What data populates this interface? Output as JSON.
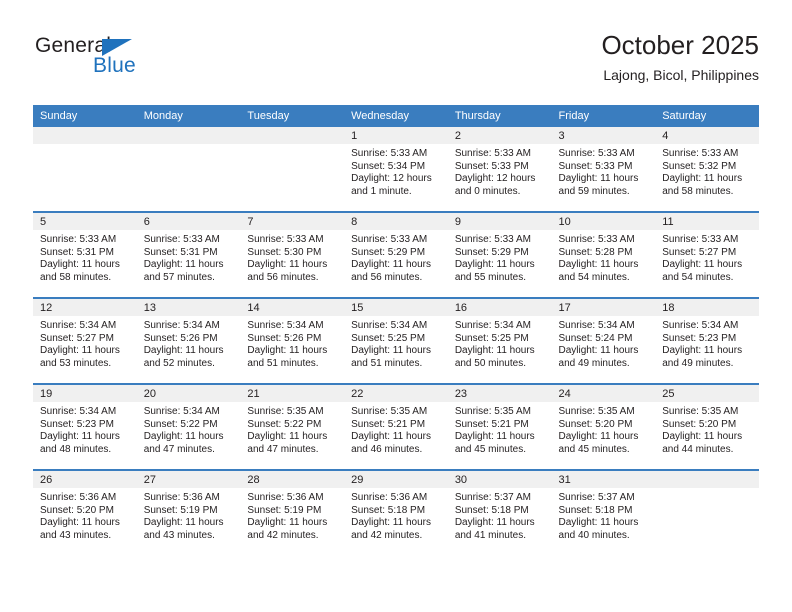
{
  "brand": {
    "name_part1": "General",
    "name_part2": "Blue",
    "triangle_color": "#1f72bd"
  },
  "header": {
    "title": "October 2025",
    "subtitle": "Lajong, Bicol, Philippines"
  },
  "theme": {
    "header_blue": "#3a7dbf",
    "daynum_band": "#f0f0f0",
    "text": "#231f20"
  },
  "weekdays": [
    "Sunday",
    "Monday",
    "Tuesday",
    "Wednesday",
    "Thursday",
    "Friday",
    "Saturday"
  ],
  "weeks": [
    [
      {
        "day": "",
        "empty": true
      },
      {
        "day": "",
        "empty": true
      },
      {
        "day": "",
        "empty": true
      },
      {
        "day": "1",
        "sunrise": "Sunrise: 5:33 AM",
        "sunset": "Sunset: 5:34 PM",
        "daylight1": "Daylight: 12 hours",
        "daylight2": "and 1 minute."
      },
      {
        "day": "2",
        "sunrise": "Sunrise: 5:33 AM",
        "sunset": "Sunset: 5:33 PM",
        "daylight1": "Daylight: 12 hours",
        "daylight2": "and 0 minutes."
      },
      {
        "day": "3",
        "sunrise": "Sunrise: 5:33 AM",
        "sunset": "Sunset: 5:33 PM",
        "daylight1": "Daylight: 11 hours",
        "daylight2": "and 59 minutes."
      },
      {
        "day": "4",
        "sunrise": "Sunrise: 5:33 AM",
        "sunset": "Sunset: 5:32 PM",
        "daylight1": "Daylight: 11 hours",
        "daylight2": "and 58 minutes."
      }
    ],
    [
      {
        "day": "5",
        "sunrise": "Sunrise: 5:33 AM",
        "sunset": "Sunset: 5:31 PM",
        "daylight1": "Daylight: 11 hours",
        "daylight2": "and 58 minutes."
      },
      {
        "day": "6",
        "sunrise": "Sunrise: 5:33 AM",
        "sunset": "Sunset: 5:31 PM",
        "daylight1": "Daylight: 11 hours",
        "daylight2": "and 57 minutes."
      },
      {
        "day": "7",
        "sunrise": "Sunrise: 5:33 AM",
        "sunset": "Sunset: 5:30 PM",
        "daylight1": "Daylight: 11 hours",
        "daylight2": "and 56 minutes."
      },
      {
        "day": "8",
        "sunrise": "Sunrise: 5:33 AM",
        "sunset": "Sunset: 5:29 PM",
        "daylight1": "Daylight: 11 hours",
        "daylight2": "and 56 minutes."
      },
      {
        "day": "9",
        "sunrise": "Sunrise: 5:33 AM",
        "sunset": "Sunset: 5:29 PM",
        "daylight1": "Daylight: 11 hours",
        "daylight2": "and 55 minutes."
      },
      {
        "day": "10",
        "sunrise": "Sunrise: 5:33 AM",
        "sunset": "Sunset: 5:28 PM",
        "daylight1": "Daylight: 11 hours",
        "daylight2": "and 54 minutes."
      },
      {
        "day": "11",
        "sunrise": "Sunrise: 5:33 AM",
        "sunset": "Sunset: 5:27 PM",
        "daylight1": "Daylight: 11 hours",
        "daylight2": "and 54 minutes."
      }
    ],
    [
      {
        "day": "12",
        "sunrise": "Sunrise: 5:34 AM",
        "sunset": "Sunset: 5:27 PM",
        "daylight1": "Daylight: 11 hours",
        "daylight2": "and 53 minutes."
      },
      {
        "day": "13",
        "sunrise": "Sunrise: 5:34 AM",
        "sunset": "Sunset: 5:26 PM",
        "daylight1": "Daylight: 11 hours",
        "daylight2": "and 52 minutes."
      },
      {
        "day": "14",
        "sunrise": "Sunrise: 5:34 AM",
        "sunset": "Sunset: 5:26 PM",
        "daylight1": "Daylight: 11 hours",
        "daylight2": "and 51 minutes."
      },
      {
        "day": "15",
        "sunrise": "Sunrise: 5:34 AM",
        "sunset": "Sunset: 5:25 PM",
        "daylight1": "Daylight: 11 hours",
        "daylight2": "and 51 minutes."
      },
      {
        "day": "16",
        "sunrise": "Sunrise: 5:34 AM",
        "sunset": "Sunset: 5:25 PM",
        "daylight1": "Daylight: 11 hours",
        "daylight2": "and 50 minutes."
      },
      {
        "day": "17",
        "sunrise": "Sunrise: 5:34 AM",
        "sunset": "Sunset: 5:24 PM",
        "daylight1": "Daylight: 11 hours",
        "daylight2": "and 49 minutes."
      },
      {
        "day": "18",
        "sunrise": "Sunrise: 5:34 AM",
        "sunset": "Sunset: 5:23 PM",
        "daylight1": "Daylight: 11 hours",
        "daylight2": "and 49 minutes."
      }
    ],
    [
      {
        "day": "19",
        "sunrise": "Sunrise: 5:34 AM",
        "sunset": "Sunset: 5:23 PM",
        "daylight1": "Daylight: 11 hours",
        "daylight2": "and 48 minutes."
      },
      {
        "day": "20",
        "sunrise": "Sunrise: 5:34 AM",
        "sunset": "Sunset: 5:22 PM",
        "daylight1": "Daylight: 11 hours",
        "daylight2": "and 47 minutes."
      },
      {
        "day": "21",
        "sunrise": "Sunrise: 5:35 AM",
        "sunset": "Sunset: 5:22 PM",
        "daylight1": "Daylight: 11 hours",
        "daylight2": "and 47 minutes."
      },
      {
        "day": "22",
        "sunrise": "Sunrise: 5:35 AM",
        "sunset": "Sunset: 5:21 PM",
        "daylight1": "Daylight: 11 hours",
        "daylight2": "and 46 minutes."
      },
      {
        "day": "23",
        "sunrise": "Sunrise: 5:35 AM",
        "sunset": "Sunset: 5:21 PM",
        "daylight1": "Daylight: 11 hours",
        "daylight2": "and 45 minutes."
      },
      {
        "day": "24",
        "sunrise": "Sunrise: 5:35 AM",
        "sunset": "Sunset: 5:20 PM",
        "daylight1": "Daylight: 11 hours",
        "daylight2": "and 45 minutes."
      },
      {
        "day": "25",
        "sunrise": "Sunrise: 5:35 AM",
        "sunset": "Sunset: 5:20 PM",
        "daylight1": "Daylight: 11 hours",
        "daylight2": "and 44 minutes."
      }
    ],
    [
      {
        "day": "26",
        "sunrise": "Sunrise: 5:36 AM",
        "sunset": "Sunset: 5:20 PM",
        "daylight1": "Daylight: 11 hours",
        "daylight2": "and 43 minutes."
      },
      {
        "day": "27",
        "sunrise": "Sunrise: 5:36 AM",
        "sunset": "Sunset: 5:19 PM",
        "daylight1": "Daylight: 11 hours",
        "daylight2": "and 43 minutes."
      },
      {
        "day": "28",
        "sunrise": "Sunrise: 5:36 AM",
        "sunset": "Sunset: 5:19 PM",
        "daylight1": "Daylight: 11 hours",
        "daylight2": "and 42 minutes."
      },
      {
        "day": "29",
        "sunrise": "Sunrise: 5:36 AM",
        "sunset": "Sunset: 5:18 PM",
        "daylight1": "Daylight: 11 hours",
        "daylight2": "and 42 minutes."
      },
      {
        "day": "30",
        "sunrise": "Sunrise: 5:37 AM",
        "sunset": "Sunset: 5:18 PM",
        "daylight1": "Daylight: 11 hours",
        "daylight2": "and 41 minutes."
      },
      {
        "day": "31",
        "sunrise": "Sunrise: 5:37 AM",
        "sunset": "Sunset: 5:18 PM",
        "daylight1": "Daylight: 11 hours",
        "daylight2": "and 40 minutes."
      },
      {
        "day": "",
        "empty": true
      }
    ]
  ]
}
